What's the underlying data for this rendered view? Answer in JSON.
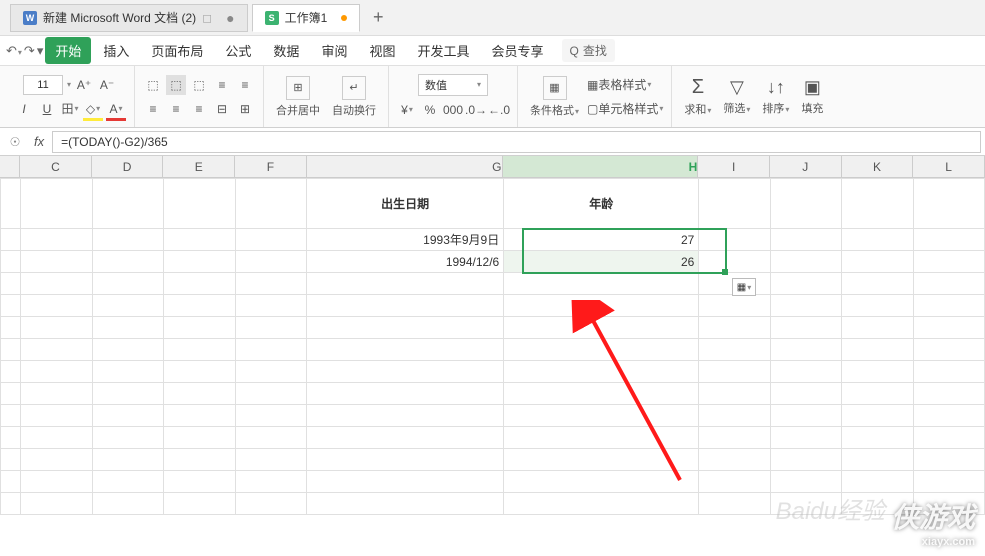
{
  "tabs": {
    "word": "新建 Microsoft Word 文档 (2)",
    "excel": "工作簿1"
  },
  "menu": {
    "start": "开始",
    "insert": "插入",
    "page_layout": "页面布局",
    "formula": "公式",
    "data": "数据",
    "review": "审阅",
    "view": "视图",
    "dev": "开发工具",
    "member": "会员专享",
    "search": "查找"
  },
  "ribbon": {
    "font_size": "11",
    "merge": "合并居中",
    "wrap": "自动换行",
    "num_format": "数值",
    "cond_format": "条件格式",
    "table_style": "表格样式",
    "cell_style": "单元格样式",
    "sum": "求和",
    "filter": "筛选",
    "sort": "排序",
    "fill": "填充"
  },
  "formula": "=(TODAY()-G2)/365",
  "columns": [
    "C",
    "D",
    "E",
    "F",
    "G",
    "H",
    "I",
    "J",
    "K",
    "L"
  ],
  "sheet": {
    "h_birth": "出生日期",
    "h_age": "年龄",
    "rows": [
      {
        "birth": "1993年9月9日",
        "age": "27"
      },
      {
        "birth": "1994/12/6",
        "age": "26"
      }
    ]
  },
  "watermark": {
    "site": "xiayx.com",
    "brand": "侠游戏",
    "baidu": "Baidu经验"
  },
  "chart_data": {
    "type": "table",
    "title": "",
    "columns": [
      "出生日期",
      "年龄"
    ],
    "rows": [
      [
        "1993年9月9日",
        27
      ],
      [
        "1994/12/6",
        26
      ]
    ]
  }
}
